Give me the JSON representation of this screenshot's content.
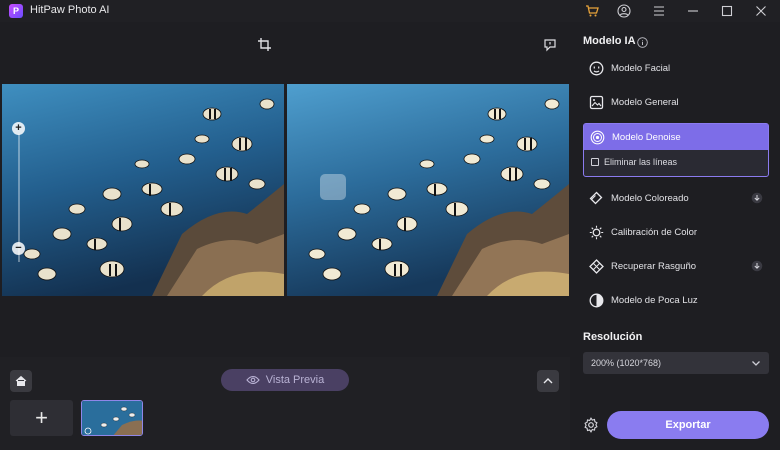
{
  "app": {
    "title": "HitPaw Photo AI",
    "logo_letter": "P",
    "accent": "#8a7cf0"
  },
  "titlebar": {
    "icons": [
      "cart-icon",
      "account-icon",
      "menu-icon",
      "minimize-icon",
      "maximize-icon",
      "close-icon"
    ]
  },
  "toolbar": {
    "icons": [
      "crop-icon",
      "feedback-icon"
    ]
  },
  "zoom": {
    "plus": "+",
    "minus": "−"
  },
  "bottom": {
    "preview_label": "Vista Previa",
    "add_label": "+"
  },
  "sidebar": {
    "title": "Modelo IA",
    "models": [
      {
        "label": "Modelo Facial",
        "icon": "face-icon",
        "download": false
      },
      {
        "label": "Modelo General",
        "icon": "image-icon",
        "download": false
      },
      {
        "label": "Modelo Denoise",
        "icon": "denoise-icon",
        "download": false,
        "selected": true
      },
      {
        "label": "Modelo Coloreado",
        "icon": "colorize-icon",
        "download": true
      },
      {
        "label": "Calibración de Color",
        "icon": "sun-icon",
        "download": false
      },
      {
        "label": "Recuperar Rasguño",
        "icon": "scratch-icon",
        "download": true
      },
      {
        "label": "Modelo de Poca Luz",
        "icon": "lowlight-icon",
        "download": false
      }
    ],
    "denoise_option": "Eliminar las líneas",
    "resolution_title": "Resolución",
    "resolution_value": "200% (1020*768)",
    "export_label": "Exportar"
  }
}
